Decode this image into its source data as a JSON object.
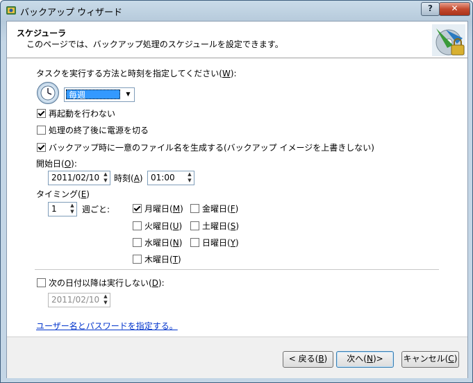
{
  "window": {
    "title": "バックアップ ウィザード",
    "help_label": "?",
    "close_label": "✕"
  },
  "header": {
    "title": "スケジューラ",
    "subtitle": "このページでは、バックアップ処理のスケジュールを設定できます。"
  },
  "task": {
    "label_pre": "タスクを実行する方法と時刻を指定してください(",
    "label_key": "W",
    "label_post": "):",
    "frequency": "毎週"
  },
  "options": {
    "no_restart": {
      "label": "再起動を行わない",
      "checked": true
    },
    "shutdown_after": {
      "label": "処理の終了後に電源を切る",
      "checked": false
    },
    "unique_name": {
      "label": "バックアップ時に一意のファイル名を生成する(バックアップ イメージを上書きしない)",
      "checked": true
    }
  },
  "start": {
    "label_pre": "開始日(",
    "label_key": "O",
    "label_post": "):",
    "date": "2011/02/10",
    "time_label_pre": "時刻(",
    "time_label_key": "A",
    "time_label_post": ")",
    "time": "01:00"
  },
  "timing": {
    "label_pre": "タイミング(",
    "label_key": "E",
    "label_post": ")",
    "weeks": "1",
    "every_weeks_label": "週ごと:",
    "days": [
      {
        "label": "月曜日",
        "key": "M",
        "checked": true
      },
      {
        "label": "火曜日",
        "key": "U",
        "checked": false
      },
      {
        "label": "水曜日",
        "key": "N",
        "checked": false
      },
      {
        "label": "木曜日",
        "key": "T",
        "checked": false
      },
      {
        "label": "金曜日",
        "key": "F",
        "checked": false
      },
      {
        "label": "土曜日",
        "key": "S",
        "checked": false
      },
      {
        "label": "日曜日",
        "key": "Y",
        "checked": false
      }
    ]
  },
  "end": {
    "label_pre": "次の日付以降は実行しない(",
    "label_key": "D",
    "label_post": "):",
    "checked": false,
    "date": "2011/02/10"
  },
  "credentials_link": "ユーザー名とパスワードを指定する。",
  "footer": {
    "back": {
      "pre": "< 戻る(",
      "key": "B",
      "post": ")"
    },
    "next": {
      "pre": "次へ(",
      "key": "N",
      "post": ")>"
    },
    "cancel": {
      "pre": "キャンセル(",
      "key": "C",
      "post": ")"
    }
  }
}
